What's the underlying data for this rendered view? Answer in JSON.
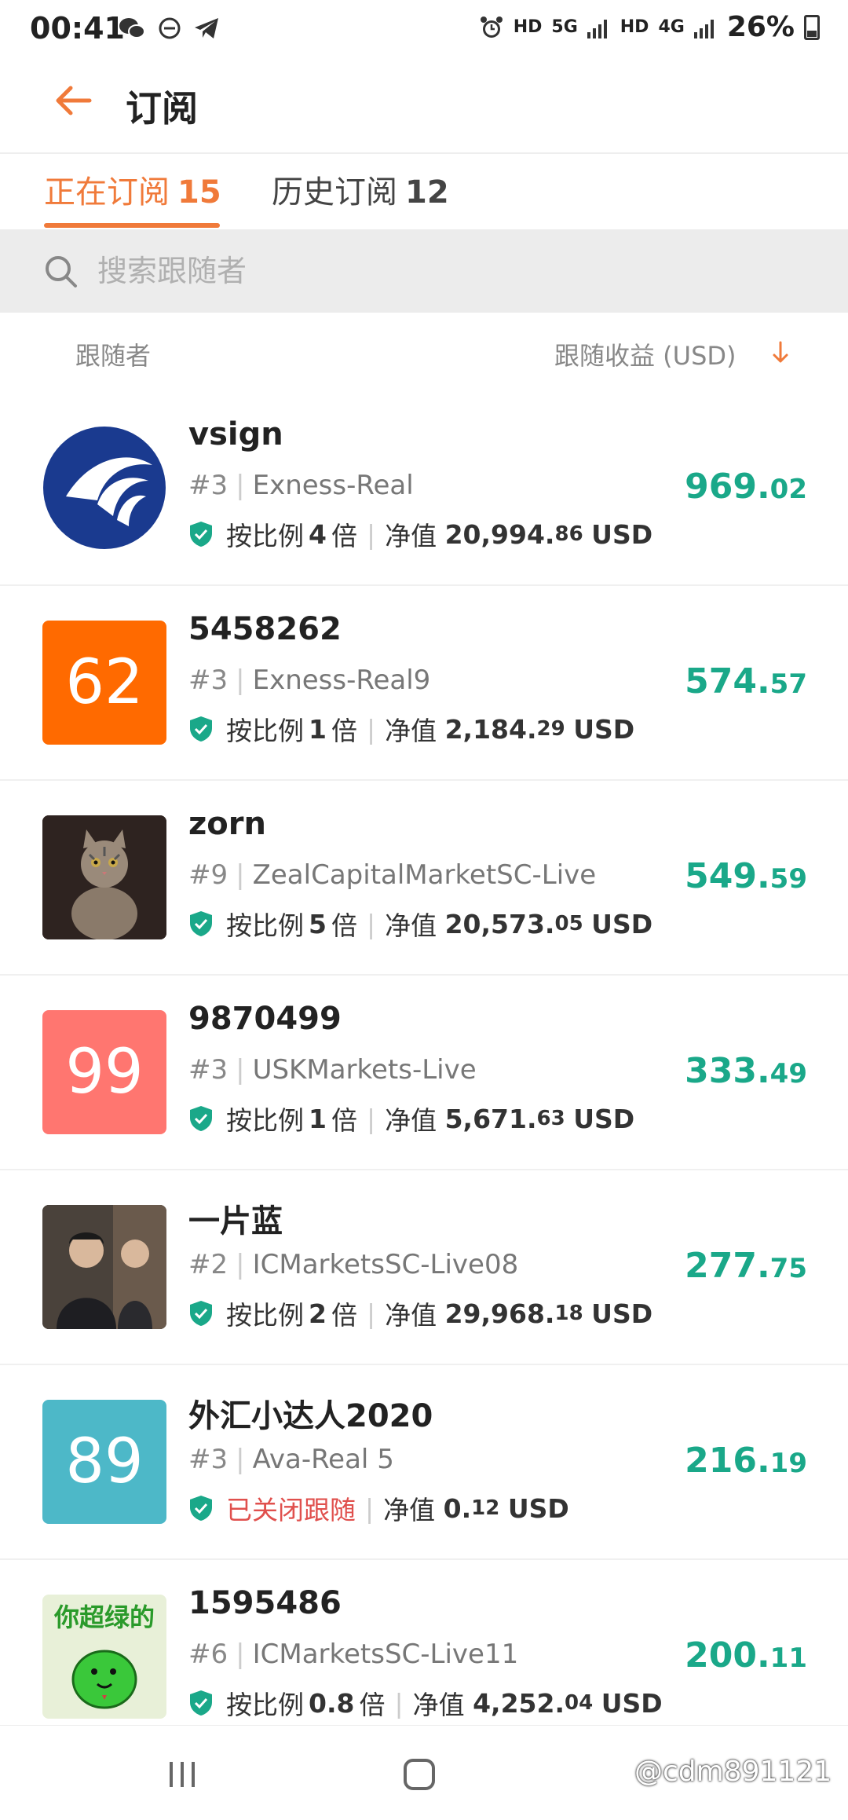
{
  "status_bar": {
    "time": "00:41",
    "battery": "26%",
    "icons": [
      "wechat-icon",
      "dnd-icon",
      "telegram-icon",
      "alarm-icon",
      "hd-icon",
      "5g-icon",
      "signal-icon",
      "hd-icon",
      "4g-icon",
      "signal-icon",
      "battery-icon"
    ],
    "hd": "HD",
    "g5": "5G",
    "g4": "4G"
  },
  "header": {
    "title": "订阅"
  },
  "tabs": [
    {
      "label": "正在订阅",
      "count": "15",
      "active": true
    },
    {
      "label": "历史订阅",
      "count": "12",
      "active": false
    }
  ],
  "search": {
    "placeholder": "搜索跟随者"
  },
  "columns": {
    "left": "跟随者",
    "right": "跟随收益 (USD)"
  },
  "colors": {
    "accent": "#f07a3a",
    "profit": "#1aa889",
    "closed": "#e0504d"
  },
  "items": [
    {
      "name": "vsign",
      "rank": "#3",
      "server": "Exness-Real",
      "ratio_label": "按比例",
      "ratio": "4",
      "ratio_unit": "倍",
      "nav_label": "净值",
      "nav_int": "20,994.",
      "nav_dec": "86",
      "currency": "USD",
      "profit_int": "969.",
      "profit_dec": "02",
      "avatar_type": "logo",
      "avatar_text": ""
    },
    {
      "name": "5458262",
      "rank": "#3",
      "server": "Exness-Real9",
      "ratio_label": "按比例",
      "ratio": "1",
      "ratio_unit": "倍",
      "nav_label": "净值",
      "nav_int": "2,184.",
      "nav_dec": "29",
      "currency": "USD",
      "profit_int": "574.",
      "profit_dec": "57",
      "avatar_type": "number",
      "avatar_text": "62",
      "avatar_color": "#ff6a00"
    },
    {
      "name": "zorn",
      "rank": "#9",
      "server": "ZealCapitalMarketSC-Live",
      "ratio_label": "按比例",
      "ratio": "5",
      "ratio_unit": "倍",
      "nav_label": "净值",
      "nav_int": "20,573.",
      "nav_dec": "05",
      "currency": "USD",
      "profit_int": "549.",
      "profit_dec": "59",
      "avatar_type": "cat",
      "avatar_text": ""
    },
    {
      "name": "9870499",
      "rank": "#3",
      "server": "USKMarkets-Live",
      "ratio_label": "按比例",
      "ratio": "1",
      "ratio_unit": "倍",
      "nav_label": "净值",
      "nav_int": "5,671.",
      "nav_dec": "63",
      "currency": "USD",
      "profit_int": "333.",
      "profit_dec": "49",
      "avatar_type": "number",
      "avatar_text": "99",
      "avatar_color": "#ff7670"
    },
    {
      "name": "一片蓝",
      "rank": "#2",
      "server": "ICMarketsSC-Live08",
      "ratio_label": "按比例",
      "ratio": "2",
      "ratio_unit": "倍",
      "nav_label": "净值",
      "nav_int": "29,968.",
      "nav_dec": "18",
      "currency": "USD",
      "profit_int": "277.",
      "profit_dec": "75",
      "avatar_type": "photo",
      "avatar_text": ""
    },
    {
      "name": "外汇小达人2020",
      "rank": "#3",
      "server": "Ava-Real 5",
      "ratio_label": "",
      "ratio": "",
      "ratio_unit": "",
      "status_text": "已关闭跟随",
      "nav_label": "净值",
      "nav_int": "0.",
      "nav_dec": "12",
      "currency": "USD",
      "profit_int": "216.",
      "profit_dec": "19",
      "avatar_type": "number",
      "avatar_text": "89",
      "avatar_color": "#4db8c8"
    },
    {
      "name": "1595486",
      "rank": "#6",
      "server": "ICMarketsSC-Live11",
      "ratio_label": "按比例",
      "ratio": "0.8",
      "ratio_unit": "倍",
      "nav_label": "净值",
      "nav_int": "4,252.",
      "nav_dec": "04",
      "currency": "USD",
      "profit_int": "200.",
      "profit_dec": "11",
      "avatar_type": "meme",
      "avatar_text": "你超绿的"
    }
  ],
  "watermark": "@cdm891121"
}
